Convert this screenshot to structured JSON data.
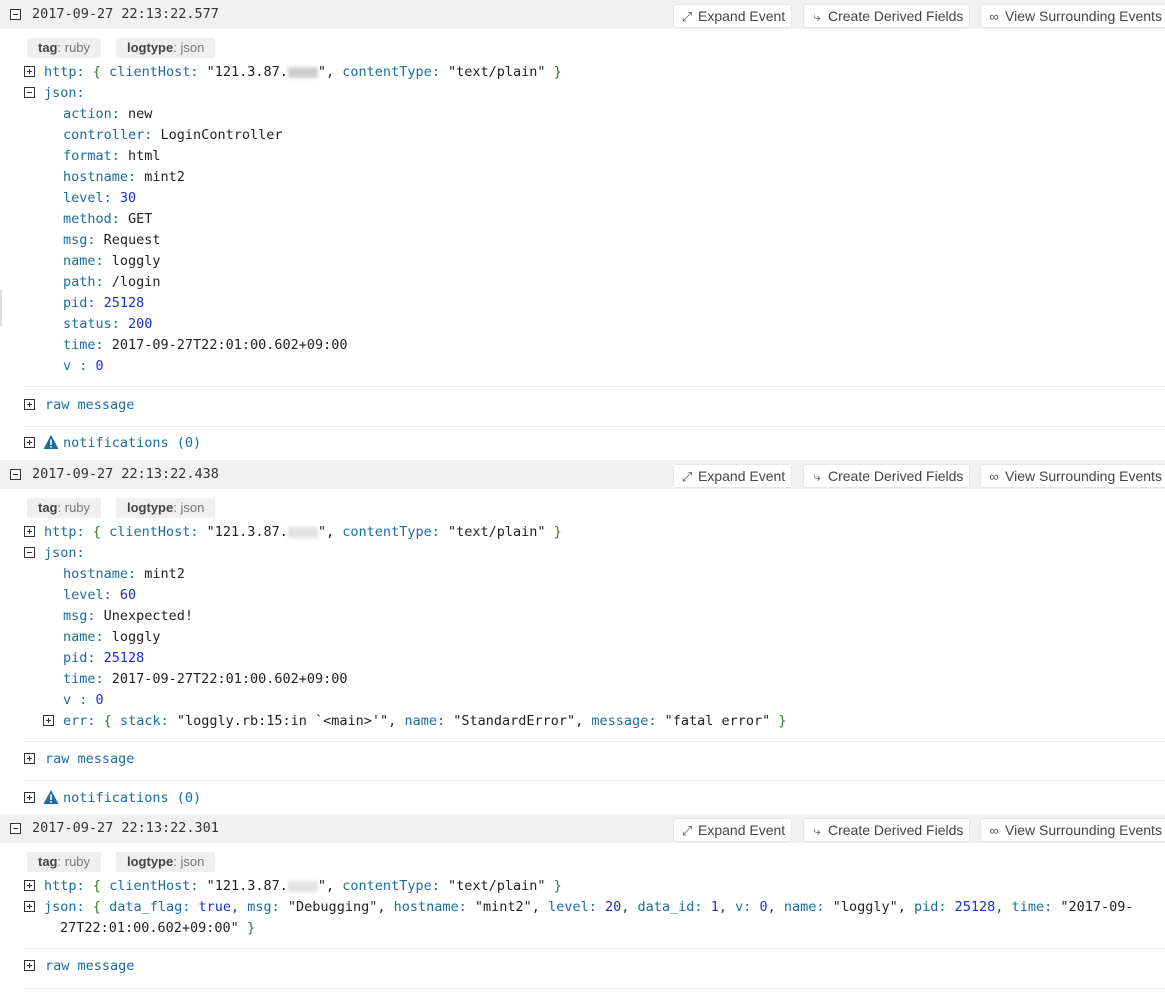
{
  "buttons": {
    "expand": "Expand Event",
    "derived": "Create Derived Fields",
    "surrounding": "View Surrounding Events"
  },
  "colors": {
    "key": "#1a6d9e",
    "number": "#1a2fcc",
    "brace": "#2f7d2f",
    "header_bg": "#f1f1f1"
  },
  "events": [
    {
      "timestamp": "2017-09-27 22:13:22.577",
      "tags": [
        {
          "key": "tag",
          "value": "ruby"
        },
        {
          "key": "logtype",
          "value": "json"
        }
      ],
      "http": {
        "label": "http:",
        "clientHost_key": "clientHost:",
        "clientHost_val": "\"121.3.87.",
        "clientHost_end": "\",",
        "contentType_key": "contentType:",
        "contentType_val": "\"text/plain\""
      },
      "json_label": "json:",
      "fields": [
        {
          "k": "action:",
          "v": "new",
          "t": "s"
        },
        {
          "k": "controller:",
          "v": "LoginController",
          "t": "s"
        },
        {
          "k": "format:",
          "v": "html",
          "t": "s"
        },
        {
          "k": "hostname:",
          "v": "mint2",
          "t": "s"
        },
        {
          "k": "level:",
          "v": "30",
          "t": "n"
        },
        {
          "k": "method:",
          "v": "GET",
          "t": "s"
        },
        {
          "k": "msg:",
          "v": "Request",
          "t": "s"
        },
        {
          "k": "name:",
          "v": "loggly",
          "t": "s"
        },
        {
          "k": "path:",
          "v": "/login",
          "t": "s"
        },
        {
          "k": "pid:",
          "v": "25128",
          "t": "n"
        },
        {
          "k": "status:",
          "v": "200",
          "t": "n"
        },
        {
          "k": "time:",
          "v": "2017-09-27T22:01:00.602+09:00",
          "t": "s"
        },
        {
          "k": "v :",
          "v": "0",
          "t": "n"
        }
      ],
      "raw": "raw message",
      "notifications": "notifications (0)"
    },
    {
      "timestamp": "2017-09-27 22:13:22.438",
      "tags": [
        {
          "key": "tag",
          "value": "ruby"
        },
        {
          "key": "logtype",
          "value": "json"
        }
      ],
      "http": {
        "label": "http:",
        "clientHost_key": "clientHost:",
        "clientHost_val": "\"121.3.87.",
        "clientHost_end": "\",",
        "contentType_key": "contentType:",
        "contentType_val": "\"text/plain\""
      },
      "json_label": "json:",
      "fields": [
        {
          "k": "hostname:",
          "v": "mint2",
          "t": "s"
        },
        {
          "k": "level:",
          "v": "60",
          "t": "n"
        },
        {
          "k": "msg:",
          "v": "Unexpected!",
          "t": "s"
        },
        {
          "k": "name:",
          "v": "loggly",
          "t": "s"
        },
        {
          "k": "pid:",
          "v": "25128",
          "t": "n"
        },
        {
          "k": "time:",
          "v": "2017-09-27T22:01:00.602+09:00",
          "t": "s"
        },
        {
          "k": "v :",
          "v": "0",
          "t": "n"
        }
      ],
      "err": {
        "label": "err:",
        "stack_key": "stack:",
        "stack_val": "\"loggly.rb:15:in `<main>'\",",
        "name_key": "name:",
        "name_val": "\"StandardError\",",
        "message_key": "message:",
        "message_val": "\"fatal error\""
      },
      "raw": "raw message",
      "notifications": "notifications (0)"
    },
    {
      "timestamp": "2017-09-27 22:13:22.301",
      "tags": [
        {
          "key": "tag",
          "value": "ruby"
        },
        {
          "key": "logtype",
          "value": "json"
        }
      ],
      "http": {
        "label": "http:",
        "clientHost_key": "clientHost:",
        "clientHost_val": "\"121.3.87.",
        "clientHost_end": "\",",
        "contentType_key": "contentType:",
        "contentType_val": "\"text/plain\""
      },
      "json_inline": {
        "label": "json:",
        "parts": [
          {
            "k": "data_flag:",
            "v": "true,",
            "t": "n"
          },
          {
            "k": "msg:",
            "v": "\"Debugging\",",
            "t": "s"
          },
          {
            "k": "hostname:",
            "v": "\"mint2\",",
            "t": "s"
          },
          {
            "k": "level:",
            "v": "20,",
            "t": "n"
          },
          {
            "k": "data_id:",
            "v": "1,",
            "t": "n"
          },
          {
            "k": "v:",
            "v": "0,",
            "t": "n"
          },
          {
            "k": "name:",
            "v": "\"loggly\",",
            "t": "s"
          },
          {
            "k": "pid:",
            "v": "25128,",
            "t": "n"
          },
          {
            "k": "time:",
            "v": "\"2017-09-",
            "t": "s"
          }
        ],
        "cont": "27T22:01:00.602+09:00\""
      },
      "raw": "raw message"
    }
  ]
}
